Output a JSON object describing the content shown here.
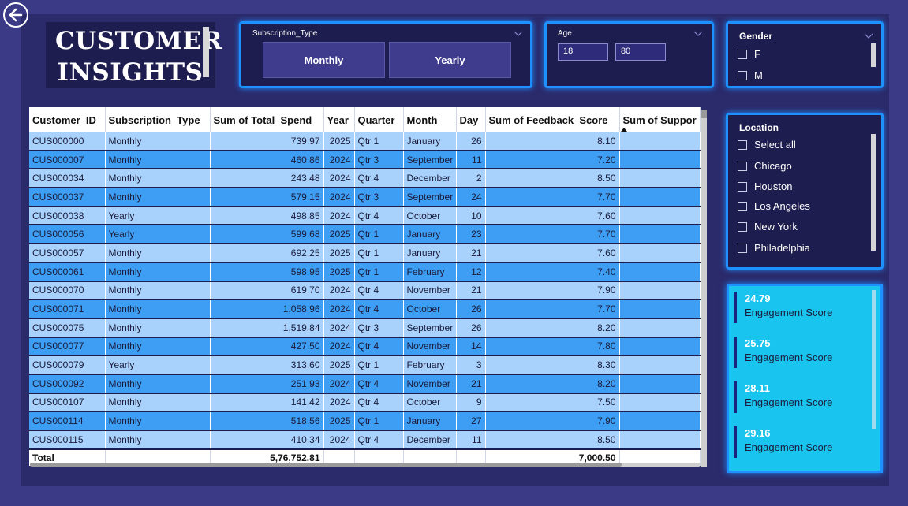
{
  "header": {
    "title_line1": "CUSTOMER",
    "title_line2": "INSIGHTS"
  },
  "subscription_slicer": {
    "title": "Subscription_Type",
    "options": [
      "Monthly",
      "Yearly"
    ]
  },
  "age_slicer": {
    "title": "Age",
    "min": "18",
    "max": "80"
  },
  "gender_slicer": {
    "title": "Gender",
    "options": [
      "F",
      "M"
    ]
  },
  "location_slicer": {
    "title": "Location",
    "options": [
      "Select all",
      "Chicago",
      "Houston",
      "Los Angeles",
      "New York",
      "Philadelphia"
    ]
  },
  "table": {
    "columns": [
      "Customer_ID",
      "Subscription_Type",
      "Sum of Total_Spend",
      "Year",
      "Quarter",
      "Month",
      "Day",
      "Sum of Feedback_Score",
      "Sum of Suppor"
    ],
    "rows": [
      [
        "CUS000000",
        "Monthly",
        "739.97",
        "2025",
        "Qtr 1",
        "January",
        "26",
        "8.10"
      ],
      [
        "CUS000007",
        "Monthly",
        "460.86",
        "2024",
        "Qtr 3",
        "September",
        "11",
        "7.20"
      ],
      [
        "CUS000034",
        "Monthly",
        "243.48",
        "2024",
        "Qtr 4",
        "December",
        "2",
        "8.50"
      ],
      [
        "CUS000037",
        "Monthly",
        "579.15",
        "2024",
        "Qtr 3",
        "September",
        "24",
        "7.70"
      ],
      [
        "CUS000038",
        "Yearly",
        "498.85",
        "2024",
        "Qtr 4",
        "October",
        "10",
        "7.60"
      ],
      [
        "CUS000056",
        "Yearly",
        "599.68",
        "2025",
        "Qtr 1",
        "January",
        "23",
        "7.70"
      ],
      [
        "CUS000057",
        "Monthly",
        "692.25",
        "2025",
        "Qtr 1",
        "January",
        "21",
        "7.60"
      ],
      [
        "CUS000061",
        "Monthly",
        "598.95",
        "2025",
        "Qtr 1",
        "February",
        "12",
        "7.40"
      ],
      [
        "CUS000070",
        "Monthly",
        "619.70",
        "2024",
        "Qtr 4",
        "November",
        "21",
        "7.90"
      ],
      [
        "CUS000071",
        "Monthly",
        "1,058.96",
        "2024",
        "Qtr 4",
        "October",
        "26",
        "7.70"
      ],
      [
        "CUS000075",
        "Monthly",
        "1,519.84",
        "2024",
        "Qtr 3",
        "September",
        "26",
        "8.20"
      ],
      [
        "CUS000077",
        "Monthly",
        "427.50",
        "2024",
        "Qtr 4",
        "November",
        "14",
        "7.80"
      ],
      [
        "CUS000079",
        "Yearly",
        "313.60",
        "2025",
        "Qtr 1",
        "February",
        "3",
        "8.30"
      ],
      [
        "CUS000092",
        "Monthly",
        "251.93",
        "2024",
        "Qtr 4",
        "November",
        "21",
        "8.20"
      ],
      [
        "CUS000107",
        "Monthly",
        "141.42",
        "2024",
        "Qtr 4",
        "October",
        "9",
        "7.50"
      ],
      [
        "CUS000114",
        "Monthly",
        "518.56",
        "2025",
        "Qtr 1",
        "January",
        "27",
        "7.90"
      ],
      [
        "CUS000115",
        "Monthly",
        "410.34",
        "2024",
        "Qtr 4",
        "December",
        "11",
        "8.50"
      ]
    ],
    "total": {
      "label": "Total",
      "total_spend": "5,76,752.81",
      "feedback_score": "7,000.50"
    }
  },
  "engagement": {
    "items": [
      {
        "value": "24.79",
        "label": "Engagement Score"
      },
      {
        "value": "25.75",
        "label": "Engagement Score"
      },
      {
        "value": "28.11",
        "label": "Engagement Score"
      },
      {
        "value": "29.16",
        "label": "Engagement Score"
      }
    ]
  },
  "colors": {
    "background": "#3b3a86",
    "panel": "#1e1d4f",
    "accent": "#1e90ff",
    "row_light": "#a8d2fb",
    "row_dark": "#3d9ef3",
    "card": "#19c4ee"
  }
}
